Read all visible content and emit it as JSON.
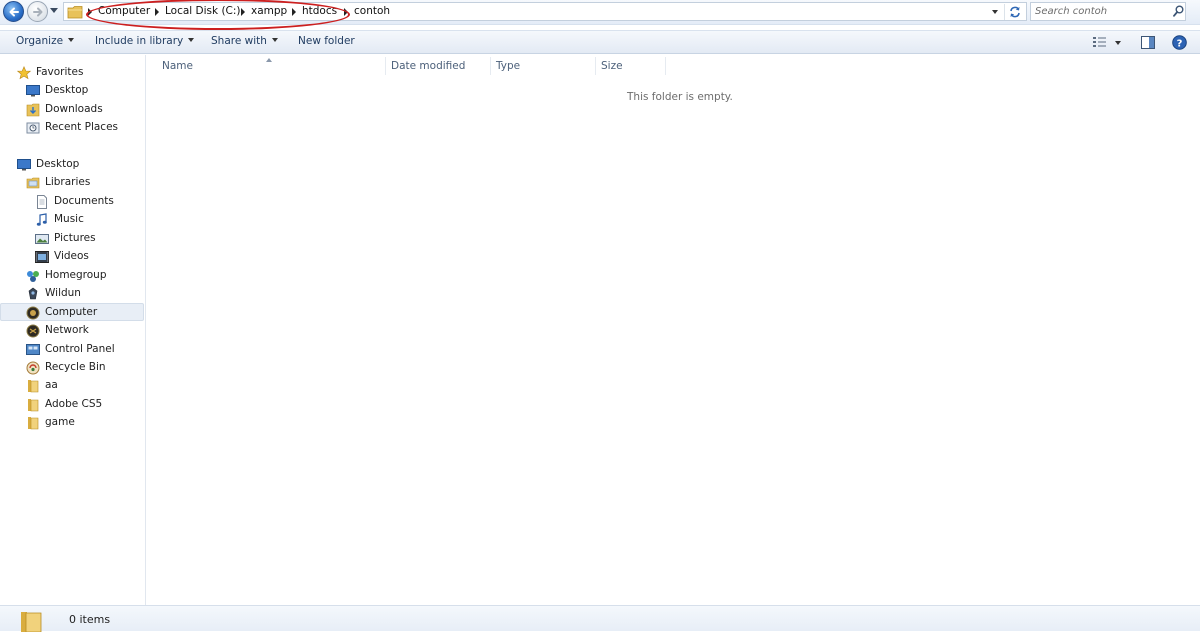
{
  "address_bar": {
    "breadcrumbs": [
      "Computer",
      "Local Disk (C:)",
      "xampp",
      "htdocs",
      "contoh"
    ]
  },
  "search": {
    "placeholder": "Search contoh"
  },
  "toolbar": {
    "organize": "Organize",
    "include_in_library": "Include in library",
    "share_with": "Share with",
    "new_folder": "New folder"
  },
  "nav": {
    "favorites": {
      "header": "Favorites",
      "items": [
        "Desktop",
        "Downloads",
        "Recent Places"
      ]
    },
    "desktop_root": "Desktop",
    "libraries": {
      "header": "Libraries",
      "items": [
        "Documents",
        "Music",
        "Pictures",
        "Videos"
      ]
    },
    "other": [
      "Homegroup",
      "Wildun",
      "Computer",
      "Network",
      "Control Panel",
      "Recycle Bin",
      "aa",
      "Adobe CS5",
      "game"
    ],
    "selected": "Computer"
  },
  "columns": [
    "Name",
    "Date modified",
    "Type",
    "Size"
  ],
  "content": {
    "empty_message": "This folder is empty."
  },
  "status": {
    "item_count": "0 items"
  },
  "colors": {
    "annotation": "#cc1f1f",
    "accent": "#2a6fc9",
    "folder": "#e8c25a"
  },
  "icons": [
    "back-arrow-icon",
    "forward-arrow-icon",
    "folder-icon",
    "refresh-icon",
    "search-icon",
    "views-icon",
    "preview-pane-icon",
    "help-icon",
    "star-icon",
    "computer-icon",
    "network-icon",
    "recycle-bin-icon"
  ]
}
